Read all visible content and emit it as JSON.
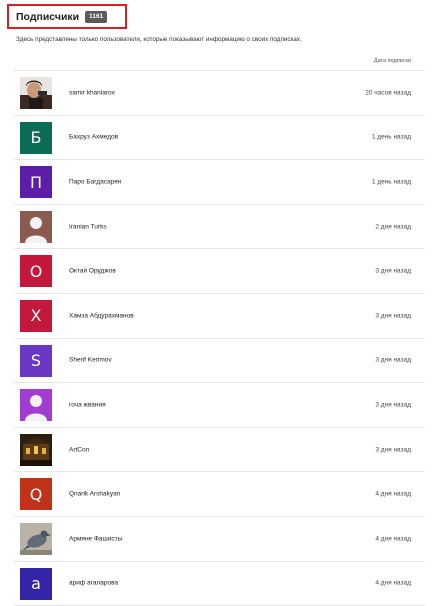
{
  "header": {
    "title": "Подписчики",
    "count": "1161",
    "highlight_color": "#d91f26"
  },
  "info_text": "Здесь представлены только пользователи, которые показывают информацию о своих подписках.",
  "table": {
    "date_column_header": "Дата подписки"
  },
  "subscribers": [
    {
      "name": "samir khanlarov",
      "date": "20 часов назад",
      "avatar": {
        "type": "photo-portrait-icon",
        "letter": "",
        "color": "#3a2a22"
      }
    },
    {
      "name": "Бахруз Ахмедов",
      "date": "1 день назад",
      "avatar": {
        "type": "letter",
        "letter": "Б",
        "color": "#0b6b55"
      }
    },
    {
      "name": "Паро Багдасарян",
      "date": "1 день назад",
      "avatar": {
        "type": "letter",
        "letter": "П",
        "color": "#5c1ea8"
      }
    },
    {
      "name": "Iranian Turks",
      "date": "2 дня назад",
      "avatar": {
        "type": "default-person-icon",
        "letter": "",
        "color": "#8a5a4e"
      }
    },
    {
      "name": "Октай Оруджов",
      "date": "3 дня назад",
      "avatar": {
        "type": "letter",
        "letter": "О",
        "color": "#c4173c"
      }
    },
    {
      "name": "Хамза Абдурахманов",
      "date": "3 дня назад",
      "avatar": {
        "type": "letter",
        "letter": "Х",
        "color": "#c4173c"
      }
    },
    {
      "name": "Sherif Kerimov",
      "date": "3 дня назад",
      "avatar": {
        "type": "letter",
        "letter": "S",
        "color": "#6a37c5"
      }
    },
    {
      "name": "гоча жвания",
      "date": "3 дня назад",
      "avatar": {
        "type": "default-person-icon",
        "letter": "",
        "color": "#a33dd1"
      }
    },
    {
      "name": "ArtCon",
      "date": "3 дня назад",
      "avatar": {
        "type": "photo-night-scene-icon",
        "letter": "",
        "color": "#2a1e10"
      }
    },
    {
      "name": "Qnarik Arshakyan",
      "date": "4 дня назад",
      "avatar": {
        "type": "letter",
        "letter": "Q",
        "color": "#c0321a"
      }
    },
    {
      "name": "Армяне Фашисты",
      "date": "4 дня назад",
      "avatar": {
        "type": "photo-bird-icon",
        "letter": "",
        "color": "#b9b2a6"
      }
    },
    {
      "name": "ариф агаларова",
      "date": "4 дня назад",
      "avatar": {
        "type": "letter",
        "letter": "a",
        "color": "#3324a8"
      }
    }
  ]
}
